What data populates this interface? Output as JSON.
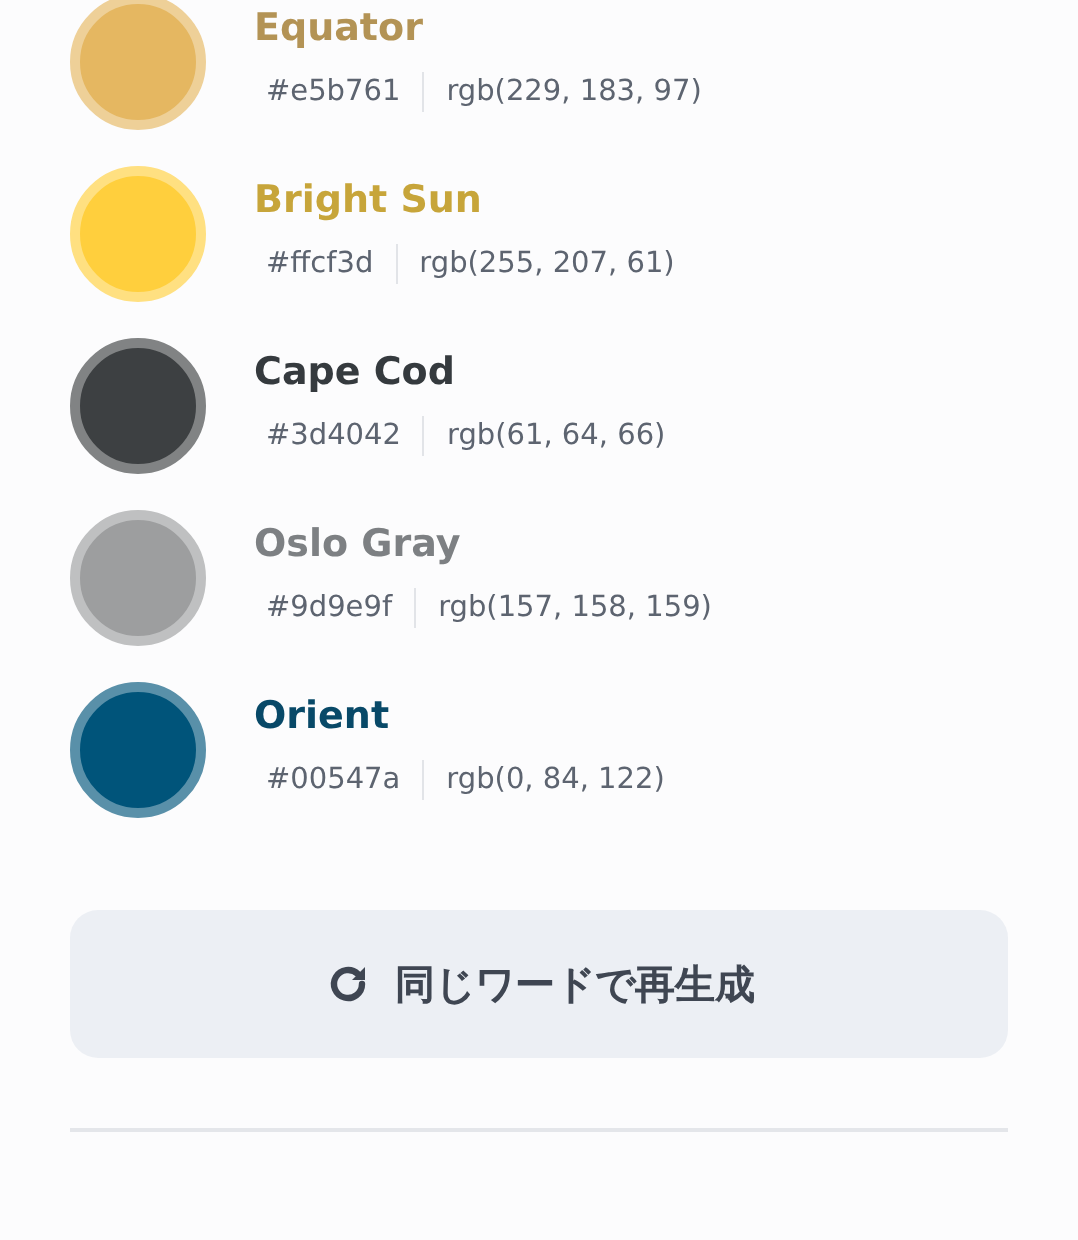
{
  "colors": [
    {
      "name": "Equator",
      "hex": "#e5b761",
      "rgb": "rgb(229, 183, 97)",
      "color": "#e5b761"
    },
    {
      "name": "Bright Sun",
      "hex": "#ffcf3d",
      "rgb": "rgb(255, 207, 61)",
      "color": "#ffcf3d"
    },
    {
      "name": "Cape Cod",
      "hex": "#3d4042",
      "rgb": "rgb(61, 64, 66)",
      "color": "#3d4042"
    },
    {
      "name": "Oslo Gray",
      "hex": "#9d9e9f",
      "rgb": "rgb(157, 158, 159)",
      "color": "#9d9e9f"
    },
    {
      "name": "Orient",
      "hex": "#00547a",
      "rgb": "rgb(0, 84, 122)",
      "color": "#00547a"
    }
  ],
  "regenerate_button": {
    "label": "同じワードで再生成"
  }
}
